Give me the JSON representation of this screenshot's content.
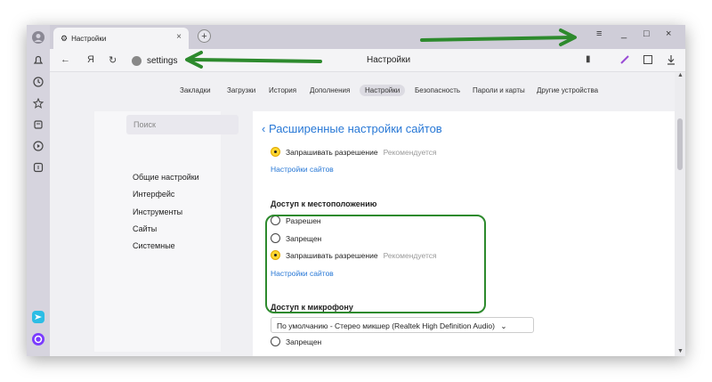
{
  "tab": {
    "title": "Настройки",
    "close": "×"
  },
  "newtab": "+",
  "window": {
    "menu": "≡",
    "minimize": "_",
    "maximize": "□",
    "close": "×"
  },
  "addrbar": {
    "back": "←",
    "ya": "Я",
    "reload": "↻",
    "url": "settings",
    "title": "Настройки"
  },
  "settings_nav": [
    "Закладки",
    "Загрузки",
    "История",
    "Дополнения",
    "Настройки",
    "Безопасность",
    "Пароли и карты",
    "Другие устройства"
  ],
  "left": {
    "search_placeholder": "Поиск",
    "items": [
      "Общие настройки",
      "Интерфейс",
      "Инструменты",
      "Сайты",
      "Системные"
    ]
  },
  "main": {
    "header": "Расширенные настройки сайтов",
    "top_option": "Запрашивать разрешение",
    "top_hint": "Рекомендуется",
    "top_link": "Настройки сайтов",
    "location": {
      "title": "Доступ к местоположению",
      "opt1": "Разрешен",
      "opt2": "Запрещен",
      "opt3": "Запрашивать разрешение",
      "opt3_hint": "Рекомендуется",
      "link": "Настройки сайтов"
    },
    "mic": {
      "title": "Доступ к микрофону",
      "select": "По умолчанию - Стерео микшер (Realtek High Definition Audio)",
      "opt_denied": "Запрещен"
    }
  },
  "colors": {
    "accent_green": "#2d8a2d",
    "link_blue": "#2878d6",
    "radio_yellow": "#ffd630"
  }
}
